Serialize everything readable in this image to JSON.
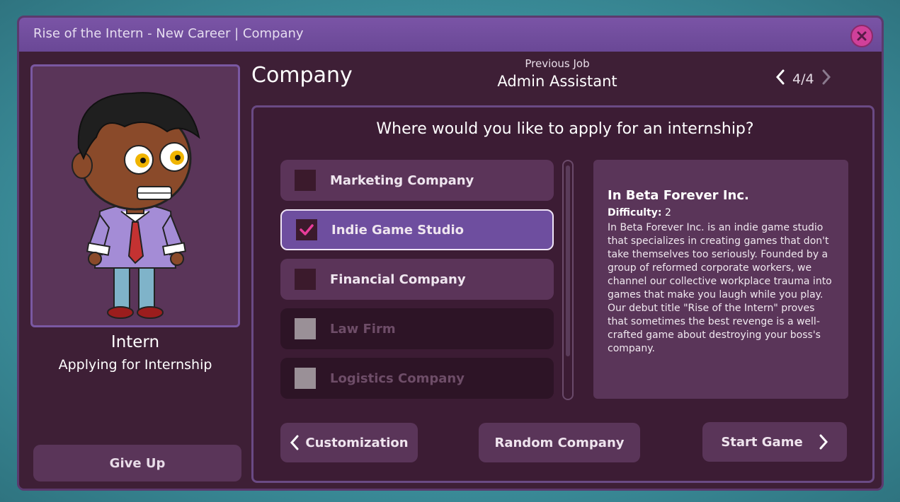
{
  "window": {
    "title": "Rise of the Intern - New Career | Company"
  },
  "character": {
    "name": "Intern",
    "subtitle": "Applying for Internship"
  },
  "give_up_label": "Give Up",
  "heading": "Company",
  "previous_job": {
    "label": "Previous Job",
    "value": "Admin Assistant"
  },
  "pager": {
    "text": "4/4"
  },
  "question": "Where would you like to apply for an internship?",
  "options": [
    {
      "label": "Marketing Company",
      "state": "unchecked"
    },
    {
      "label": "Indie Game Studio",
      "state": "checked"
    },
    {
      "label": "Financial Company",
      "state": "unchecked"
    },
    {
      "label": "Law Firm",
      "state": "disabled"
    },
    {
      "label": "Logistics Company",
      "state": "disabled"
    }
  ],
  "info": {
    "title": "In Beta Forever Inc.",
    "difficulty_label": "Difficulty:",
    "difficulty_value": "2",
    "description": "In Beta Forever Inc. is an indie game studio that specializes in creating games that don't take themselves too seriously. Founded by a group of reformed corporate workers, we channel our collective workplace trauma into games that make you laugh while you play. Our debut title \"Rise of the Intern\" proves that sometimes the best revenge is a well-crafted game about destroying your boss's company."
  },
  "buttons": {
    "customization": "Customization",
    "random": "Random Company",
    "start": "Start Game"
  },
  "colors": {
    "accent_check": "#e83c9a",
    "close": "#d0409a"
  }
}
